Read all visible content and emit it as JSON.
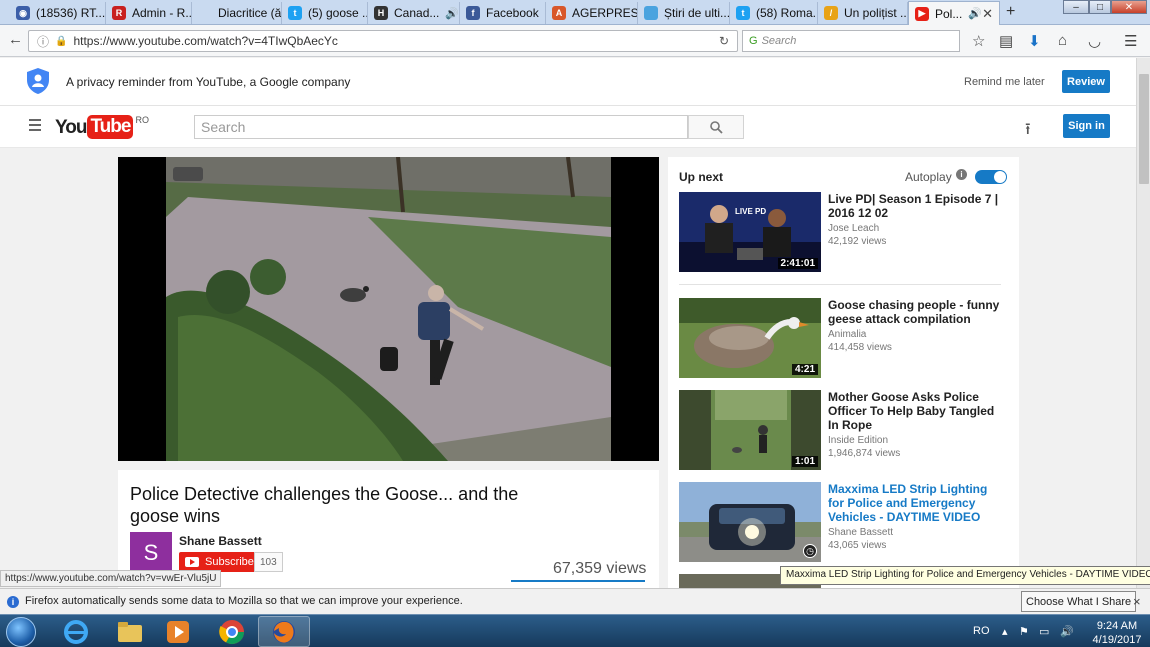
{
  "browser": {
    "tabs": [
      {
        "label": "(18536) RT...",
        "color": "#3b5ea8",
        "glyph": "◉"
      },
      {
        "label": "Admin - R...",
        "color": "#c8201f",
        "glyph": "R"
      },
      {
        "label": "Diacritice (ăâîș...",
        "color": "#777777",
        "glyph": ""
      },
      {
        "label": "(5) goose ...",
        "color": "#1da1f2",
        "glyph": "t"
      },
      {
        "label": "Canad...",
        "color": "#333333",
        "glyph": "H"
      },
      {
        "label": "Facebook",
        "color": "#3b5998",
        "glyph": "f"
      },
      {
        "label": "AGERPRES...",
        "color": "#d8572a",
        "glyph": "A"
      },
      {
        "label": "Știri de ulti...",
        "color": "#4aa3df",
        "glyph": "□"
      },
      {
        "label": "(58) Roma...",
        "color": "#1da1f2",
        "glyph": "t"
      },
      {
        "label": "Un polițist ...",
        "color": "#e8a317",
        "glyph": "/"
      },
      {
        "label": "Pol...",
        "color": "#e62117",
        "glyph": "▶"
      }
    ],
    "url": "https://www.youtube.com/watch?v=4TIwQbAecYc",
    "search_placeholder": "Search"
  },
  "privacy": {
    "text": "A privacy reminder from YouTube, a Google company",
    "remind_label": "Remind me later",
    "review_label": "Review"
  },
  "header": {
    "logo_you": "You",
    "logo_tube": "Tube",
    "logo_region": "RO",
    "search_placeholder": "Search",
    "signin_label": "Sign in"
  },
  "video": {
    "title": "Police Detective challenges the Goose... and the goose wins",
    "channel": "Shane Bassett",
    "avatar_letter": "S",
    "subscribe_label": "Subscribe",
    "subscriber_count": "103",
    "views": "67,359 views"
  },
  "sidebar": {
    "up_next": "Up next",
    "autoplay": "Autoplay",
    "autoplay_info": "i",
    "items": [
      {
        "title": "Live PD| Season 1 Episode 7 | 2016 12 02",
        "channel": "Jose Leach",
        "views": "42,192 views",
        "duration": "2:41:01",
        "thumb_badge": "LIVE PD"
      },
      {
        "title": "Goose chasing people - funny geese attack compilation",
        "channel": "Animalia",
        "views": "414,458 views",
        "duration": "4:21"
      },
      {
        "title": "Mother Goose Asks Police Officer To Help Baby Tangled In Rope",
        "channel": "Inside Edition",
        "views": "1,946,874 views",
        "duration": "1:01"
      },
      {
        "title": "Maxxima LED Strip Lighting for Police and Emergency Vehicles - DAYTIME VIDEO",
        "channel": "Shane Bassett",
        "views": "43,065 views",
        "duration": ""
      }
    ]
  },
  "status": {
    "link_url": "https://www.youtube.com/watch?v=vwEr-Vlu5jU",
    "tooltip": "Maxxima LED Strip Lighting for Police and Emergency Vehicles - DAYTIME VIDEO"
  },
  "notification": {
    "icon": "i",
    "text": "Firefox automatically sends some data to Mozilla so that we can improve your experience.",
    "button": "Choose What I Share",
    "close": "×"
  },
  "taskbar": {
    "lang": "RO",
    "time": "9:24 AM",
    "date": "4/19/2017"
  }
}
